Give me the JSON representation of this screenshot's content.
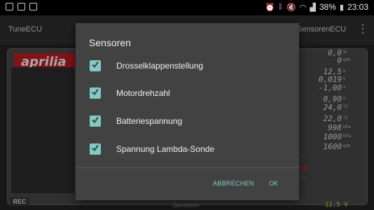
{
  "status_bar": {
    "battery": "38%",
    "time": "23:03"
  },
  "app_bar": {
    "title": "TuneECU",
    "tabs": [
      "Sensoren",
      "ECU"
    ]
  },
  "dashboard": {
    "logo": "aprilia",
    "values": [
      {
        "value": "0,0",
        "unit": "%"
      },
      {
        "value": "0",
        "unit": "rpm"
      },
      {
        "value": "12,5",
        "unit": "v"
      },
      {
        "value": "0,019",
        "unit": "v"
      },
      {
        "value": "-1,00",
        "unit": "v"
      },
      {
        "value": "0,90",
        "unit": "v"
      },
      {
        "value": "24,0",
        "unit": "°C"
      },
      {
        "value": "22,0",
        "unit": "°C"
      },
      {
        "value": "998",
        "unit": "hPa"
      },
      {
        "value": "1000",
        "unit": "hPa"
      },
      {
        "value": "1600",
        "unit": "rpm"
      }
    ],
    "rec_label": "REC",
    "bottom_label": "Sensoren",
    "voltage": "12,5 V"
  },
  "dialog": {
    "title": "Sensoren",
    "items": [
      {
        "label": "Drosselklappenstellung",
        "checked": true
      },
      {
        "label": "Motordrehzahl",
        "checked": true
      },
      {
        "label": "Batteriespannung",
        "checked": true
      },
      {
        "label": "Spannung Lambda-Sonde",
        "checked": true
      }
    ],
    "cancel_label": "ABBRECHEN",
    "ok_label": "OK",
    "accent": "#80cbc4"
  }
}
